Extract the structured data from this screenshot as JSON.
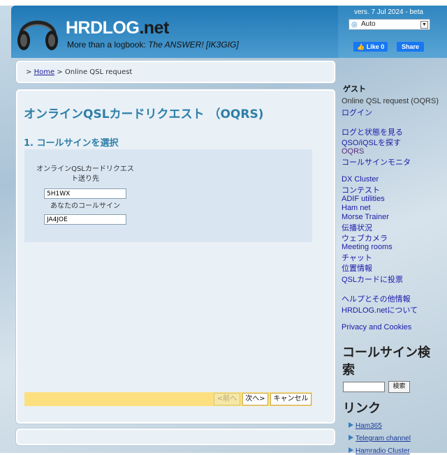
{
  "header": {
    "logo_main": "HRDLOG",
    "logo_tld": ".net",
    "tagline_prefix": "More than a logbook: ",
    "tagline_italic": "The ANSWER! [IK3GIG]",
    "version": "vers. 7 Jul 2024 - beta",
    "language_select": "Auto",
    "like_label": "Like 0",
    "share_label": "Share"
  },
  "breadcrumb": {
    "prefix": ">",
    "home": "Home",
    "sep": ">",
    "current": "Online QSL request"
  },
  "main": {
    "title": "オンラインQSLカードリクエスト （OQRS)",
    "step_title": "1. コールサインを選択",
    "form": {
      "recipient_label": "オンラインQSLカードリクエスト送り先",
      "recipient_value": "5H1WX",
      "own_call_label": "あなたのコールサイン",
      "own_call_value": "JA4JOE"
    },
    "buttons": {
      "prev": "<前へ",
      "next": "次へ>",
      "cancel": "キャンセル"
    }
  },
  "sidebar": {
    "user_heading": "ゲスト",
    "current_page": "Online QSL request (OQRS)",
    "login": "ログイン",
    "group1": [
      "ログと状態を見る",
      "QSO/iQSLを探す",
      "OQRS",
      "コールサインモニタ"
    ],
    "group2": [
      "DX Cluster",
      "コンテスト",
      "ADIF utilities",
      "Ham net",
      "Morse Trainer",
      "伝播状況",
      "ウェブカメラ",
      "Meeting rooms",
      "チャット",
      "位置情報",
      "QSLカードに投票"
    ],
    "group3": [
      "ヘルプとその他情報",
      "HRDLOG.netについて"
    ],
    "privacy": "Privacy and Cookies",
    "search_heading": "コールサイン検索",
    "search_button": "検索",
    "links_heading": "リンク",
    "links": [
      "Ham365",
      "Telegram channel",
      "Hamradio Cluster"
    ]
  },
  "colors": {
    "accent": "#2e7fa8",
    "header_blue": "#1f78b5",
    "progress_yellow": "#fce080",
    "link": "#1a1aa8"
  }
}
